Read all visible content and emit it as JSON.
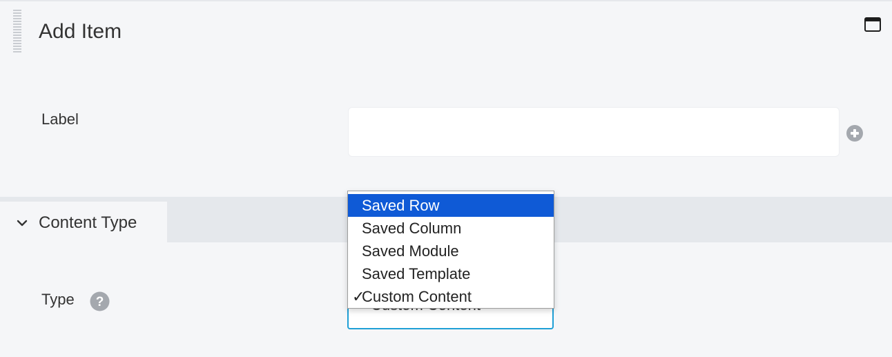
{
  "panel": {
    "title": "Add Item"
  },
  "fields": {
    "label": {
      "label": "Label",
      "value": ""
    },
    "type": {
      "label": "Type",
      "selected_value": "Custom Content"
    }
  },
  "section": {
    "title": "Content Type"
  },
  "dropdown": {
    "options": [
      {
        "label": "Saved Row",
        "highlighted": true,
        "checked": false
      },
      {
        "label": "Saved Column",
        "highlighted": false,
        "checked": false
      },
      {
        "label": "Saved Module",
        "highlighted": false,
        "checked": false
      },
      {
        "label": "Saved Template",
        "highlighted": false,
        "checked": false
      },
      {
        "label": "Custom Content",
        "highlighted": false,
        "checked": true
      }
    ],
    "check_glyph": "✓"
  },
  "icons": {
    "drag_handle": "drag-handle-icon",
    "window": "window-maximize-icon",
    "add": "plus-circle-icon",
    "collapse": "chevron-down-icon",
    "help": "question-circle-icon"
  },
  "colors": {
    "background": "#f5f6f8",
    "section_bar": "#e5e8ec",
    "focus_border": "#1e9fd6",
    "highlight": "#0f5ad6",
    "icon_gray": "#a4a8ae"
  }
}
